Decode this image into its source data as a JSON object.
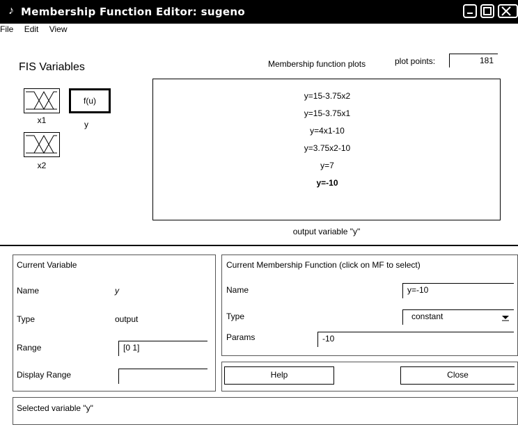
{
  "window": {
    "title": "Membership Function Editor: sugeno"
  },
  "menu": {
    "file": "File",
    "edit": "Edit",
    "view": "View"
  },
  "fis": {
    "heading": "FIS Variables",
    "inputs": [
      {
        "name": "x1"
      },
      {
        "name": "x2"
      }
    ],
    "output": {
      "name": "y",
      "symbol": "f(u)"
    }
  },
  "plot": {
    "title": "Membership function plots",
    "plot_points_label": "plot points:",
    "plot_points_value": "181",
    "mfs": [
      "y=15-3.75x2",
      "y=15-3.75x1",
      "y=4x1-10",
      "y=3.75x2-10",
      "y=7",
      "y=-10"
    ],
    "selected_mf": "y=-10",
    "caption": "output variable \"y\""
  },
  "current_variable": {
    "heading": "Current Variable",
    "name_label": "Name",
    "name_value": "y",
    "type_label": "Type",
    "type_value": "output",
    "range_label": "Range",
    "range_value": "[0 1]",
    "display_range_label": "Display Range",
    "display_range_value": ""
  },
  "current_mf": {
    "heading": "Current Membership Function (click on MF to select)",
    "name_label": "Name",
    "name_value": "y=-10",
    "type_label": "Type",
    "type_value": "constant",
    "params_label": "Params",
    "params_value": "-10"
  },
  "buttons": {
    "help": "Help",
    "close": "Close"
  },
  "status": {
    "text": "Selected variable \"y\""
  }
}
